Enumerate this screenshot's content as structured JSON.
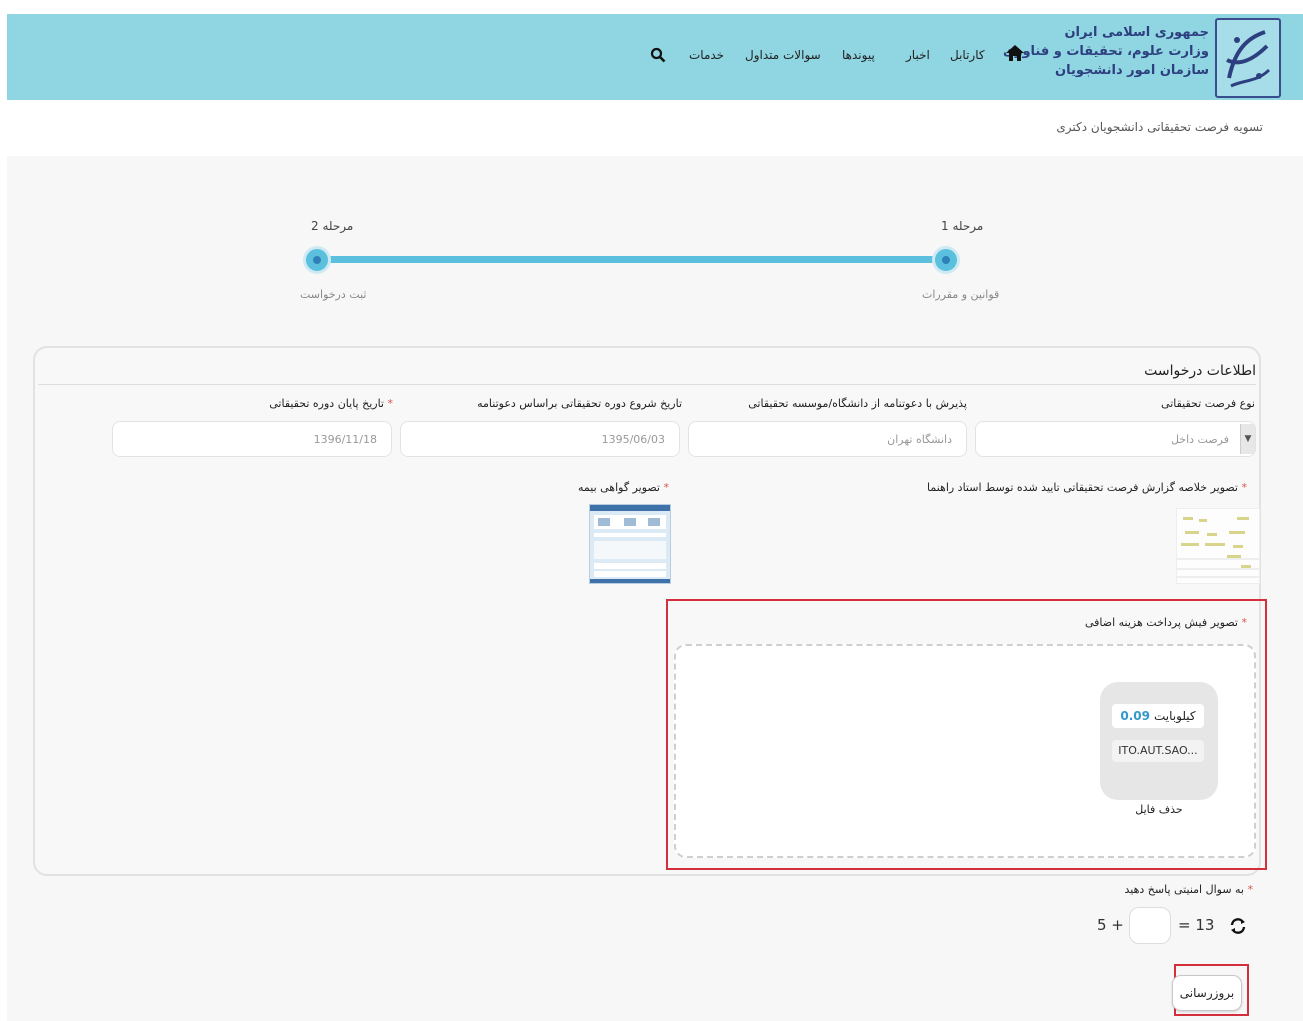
{
  "header": {
    "logo_lines": [
      "جمهوری اسلامی ایران",
      "وزارت علوم، تحقیقات و فناوری",
      "سازمان امور دانشجویان"
    ],
    "nav": {
      "home_icon": "home-icon",
      "items": [
        "کارتابل",
        "اخبار",
        "پیوندها",
        "سوالات متداول",
        "خدمات"
      ],
      "search_icon": "search-icon"
    },
    "color": "#8fd6e2"
  },
  "breadcrumb": "تسویه فرصت تحقیقاتی دانشجویان دکتری",
  "stepper": {
    "steps": [
      {
        "label": "مرحله 1",
        "sub": "قوانین و مقررات"
      },
      {
        "label": "مرحله 2",
        "sub": "ثبت درخواست"
      }
    ],
    "accent": "#5bc0de"
  },
  "request": {
    "title": "اطلاعات درخواست",
    "fields": [
      {
        "label": "نوع فرصت تحقیقاتی",
        "value": "فرصت داخل",
        "required": false
      },
      {
        "label": "پذیرش با دعوتنامه از دانشگاه/موسسه تحقیقاتی",
        "value": "دانشگاه تهران",
        "required": false
      },
      {
        "label": "تاریخ شروع دوره تحقیقاتی براساس دعوتنامه",
        "value": "1395/06/03",
        "required": false
      },
      {
        "label": "تاریخ پایان دوره تحقیقاتی",
        "value": "1396/11/18",
        "required": true
      }
    ],
    "images": [
      {
        "label": "تصویر خلاصه گزارش فرصت تحقیقاتی تایید شده توسط استاد راهنما"
      },
      {
        "label": "تصویر گواهی بیمه"
      }
    ],
    "upload": {
      "label": "تصویر فیش پرداخت هزینه اضافی",
      "file_size": "0.09",
      "file_size_unit": "کیلوبایت",
      "file_name": "ITO.AUT.SAO...",
      "remove_label": "حذف فایل"
    }
  },
  "captcha": {
    "label": "به سوال امنیتی پاسخ دهید",
    "right_text": "= 13",
    "left_text": "5 +",
    "answer": ""
  },
  "submit_label": "بروزرسانی",
  "highlight_color": "#d32f3c"
}
